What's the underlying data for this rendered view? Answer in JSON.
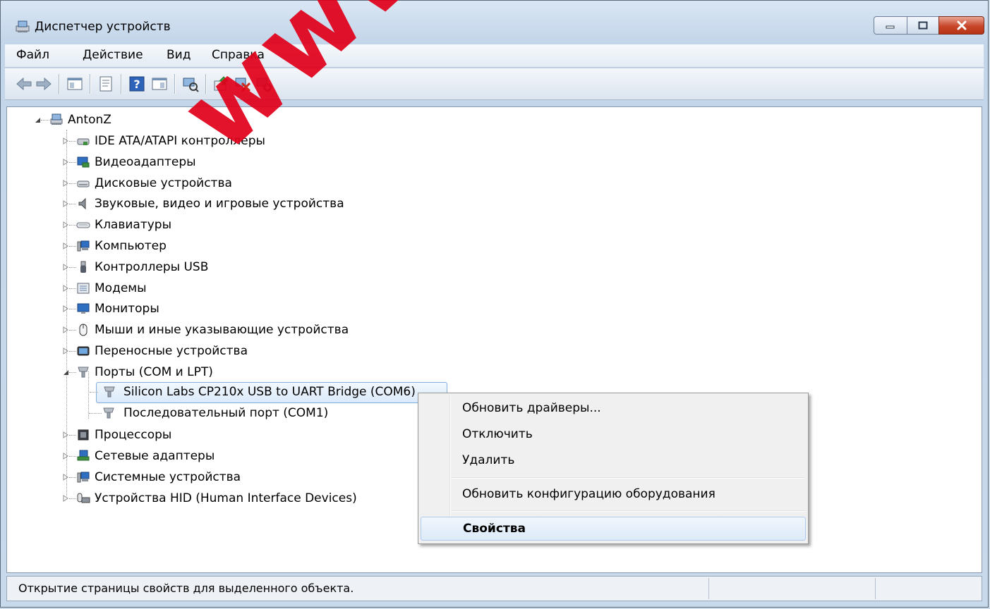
{
  "window": {
    "title": "Диспетчер устройств"
  },
  "menubar": {
    "items": [
      "Файл",
      "Действие",
      "Вид",
      "Справка"
    ]
  },
  "toolbar": {
    "icons": [
      "back-icon",
      "forward-icon",
      "show-hide-tree-icon",
      "properties-icon",
      "help-icon",
      "action-pane-icon",
      "scan-hardware-icon",
      "update-driver-icon",
      "disable-device-icon",
      "uninstall-device-icon"
    ]
  },
  "tree": {
    "root": "AntonZ",
    "categories": [
      {
        "label": "IDE ATA/ATAPI контроллеры",
        "icon": "ide-controller-icon"
      },
      {
        "label": "Видеоадаптеры",
        "icon": "display-adapter-icon"
      },
      {
        "label": "Дисковые устройства",
        "icon": "disk-drive-icon"
      },
      {
        "label": "Звуковые, видео и игровые устройства",
        "icon": "speaker-icon"
      },
      {
        "label": "Клавиатуры",
        "icon": "keyboard-icon"
      },
      {
        "label": "Компьютер",
        "icon": "computer-icon"
      },
      {
        "label": "Контроллеры USB",
        "icon": "usb-icon"
      },
      {
        "label": "Модемы",
        "icon": "modem-icon"
      },
      {
        "label": "Мониторы",
        "icon": "monitor-icon"
      },
      {
        "label": "Мыши и иные указывающие устройства",
        "icon": "mouse-icon"
      },
      {
        "label": "Переносные устройства",
        "icon": "portable-device-icon"
      },
      {
        "label": "Порты (COM и LPT)",
        "icon": "port-icon",
        "expanded": true
      },
      {
        "label": "Процессоры",
        "icon": "processor-icon"
      },
      {
        "label": "Сетевые адаптеры",
        "icon": "network-adapter-icon"
      },
      {
        "label": "Системные устройства",
        "icon": "system-device-icon"
      },
      {
        "label": "Устройства HID (Human Interface Devices)",
        "icon": "hid-icon"
      }
    ],
    "port_children": [
      {
        "label": "Silicon Labs CP210x USB to UART Bridge (COM6)",
        "selected": true
      },
      {
        "label": "Последовательный порт (COM1)"
      }
    ]
  },
  "context_menu": {
    "items": [
      {
        "label": "Обновить драйверы..."
      },
      {
        "label": "Отключить"
      },
      {
        "label": "Удалить"
      },
      {
        "label": "Обновить конфигурацию оборудования"
      },
      {
        "label": "Свойства",
        "highlighted": true
      }
    ]
  },
  "statusbar": {
    "text": "Открытие страницы свойств для выделенного объекта."
  },
  "watermark": {
    "text": "www.spb"
  }
}
